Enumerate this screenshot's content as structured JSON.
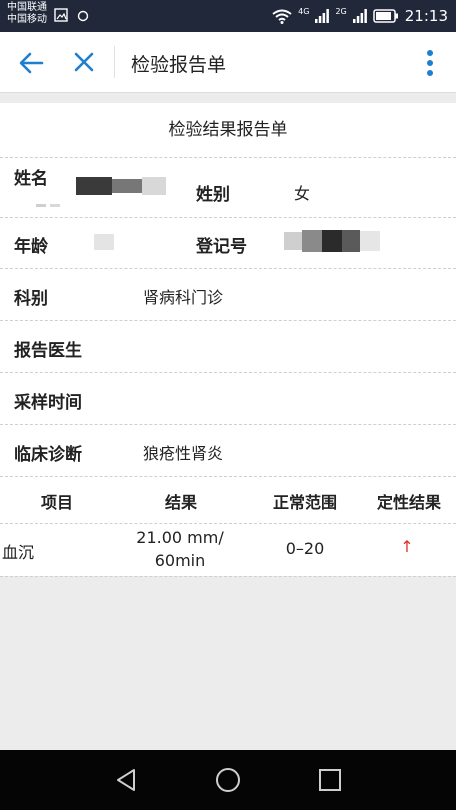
{
  "status_bar": {
    "carrier_1": "中国联通",
    "carrier_2": "中国移动",
    "net_1": "4G",
    "net_2": "2G",
    "time": "21:13"
  },
  "app_bar": {
    "title": "检验报告单"
  },
  "report": {
    "title": "检验结果报告单",
    "fields": {
      "name_label": "姓名",
      "gender_label": "姓别",
      "gender_value": "女",
      "age_label": "年龄",
      "reg_label": "登记号",
      "dept_label": "科别",
      "dept_value": "肾病科门诊",
      "doctor_label": "报告医生",
      "sample_time_label": "采样时间",
      "diagnosis_label": "临床诊断",
      "diagnosis_value": "狼疮性肾炎"
    },
    "table": {
      "headers": [
        "项目",
        "结果",
        "正常范围",
        "定性结果"
      ],
      "rows": [
        {
          "item": "血沉",
          "result_line1": "21.00 mm/",
          "result_line2": "60min",
          "range": "0–20",
          "flag": "↑"
        }
      ]
    }
  },
  "colors": {
    "accent": "#1e7fd0",
    "flag_red": "#e0302a",
    "status_bar_bg": "#20283a"
  }
}
